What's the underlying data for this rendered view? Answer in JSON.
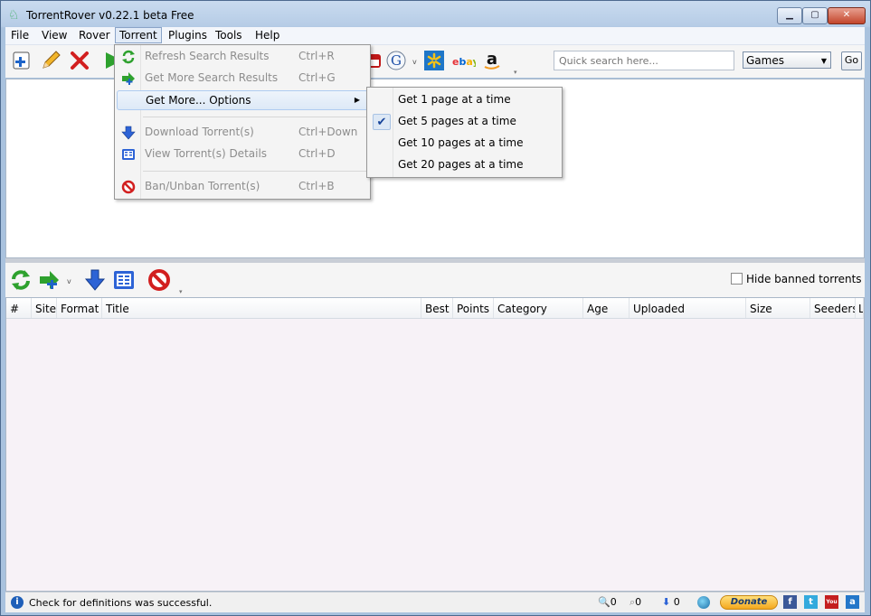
{
  "window": {
    "title": "TorrentRover v0.22.1 beta Free",
    "controls": {
      "minimize": "▁",
      "maximize": "▢",
      "close": "✕"
    }
  },
  "menubar": [
    "File",
    "View",
    "Rover",
    "Torrent",
    "Plugins",
    "Tools",
    "Help"
  ],
  "toolbar": {
    "icons": [
      "add-search-icon",
      "edit-icon",
      "delete-icon",
      "start-icon",
      "youtube-icon",
      "google-icon",
      "walmart-icon",
      "ebay-icon",
      "amazon-icon"
    ],
    "search_placeholder": "Quick search here...",
    "category": "Games",
    "go_label": "Go"
  },
  "torrent_menu": {
    "items": [
      {
        "label": "Refresh Search Results",
        "shortcut": "Ctrl+R",
        "icon": "refresh-icon",
        "disabled": true
      },
      {
        "label": "Get More Search Results",
        "shortcut": "Ctrl+G",
        "icon": "get-more-icon",
        "disabled": true
      },
      {
        "label": "Get More... Options",
        "shortcut": "",
        "icon": "",
        "disabled": false,
        "submenu": true
      },
      {
        "label": "Download Torrent(s)",
        "shortcut": "Ctrl+Down",
        "icon": "download-icon",
        "disabled": true
      },
      {
        "label": "View Torrent(s) Details",
        "shortcut": "Ctrl+D",
        "icon": "details-icon",
        "disabled": true
      },
      {
        "label": "Ban/Unban Torrent(s)",
        "shortcut": "Ctrl+B",
        "icon": "ban-icon",
        "disabled": true
      }
    ]
  },
  "get_more_options": {
    "items": [
      {
        "label": "Get 1 page at a time",
        "checked": false
      },
      {
        "label": "Get 5 pages at a time",
        "checked": true
      },
      {
        "label": "Get 10 pages at a time",
        "checked": false
      },
      {
        "label": "Get 20 pages at a time",
        "checked": false
      }
    ]
  },
  "toolbar2": {
    "hide_banned_label": "Hide banned torrents"
  },
  "grid": {
    "columns": [
      "#",
      "Site",
      "Format",
      "Title",
      "Best",
      "Points",
      "Category",
      "Age",
      "Uploaded",
      "Size",
      "Seeders",
      "L"
    ]
  },
  "status": {
    "message": "Check for definitions was successful.",
    "search_count": "0",
    "secondary_count": "0",
    "download_count": "0",
    "donate_label": "Donate",
    "social": [
      "f",
      "t",
      "You",
      "a"
    ]
  }
}
